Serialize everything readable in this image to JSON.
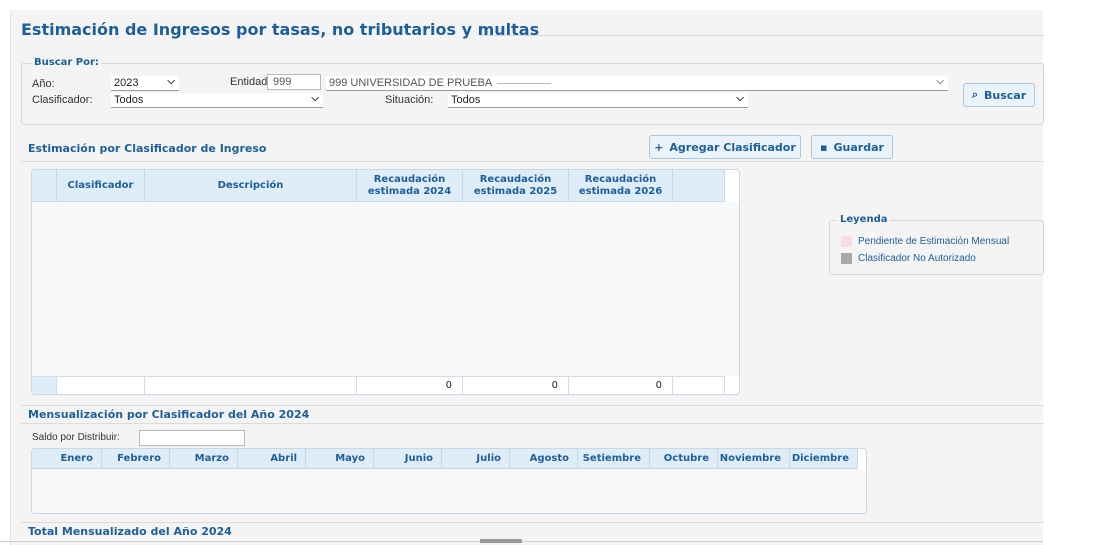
{
  "page": {
    "title": "Estimación de Ingresos por tasas, no tributarios y multas"
  },
  "search": {
    "legend": "Buscar Por:",
    "anio_label": "Año:",
    "anio_value": "2023",
    "entidad_label": "Entidad:",
    "entidad_code": "999",
    "entidad_select": "999  UNIVERSIDAD DE PRUEBA",
    "clasificador_label": "Clasificador:",
    "clasificador_value": "Todos",
    "situacion_label": "Situación:",
    "situacion_value": "Todos",
    "buscar_button": "Buscar"
  },
  "estimacion": {
    "title": "Estimación por Clasificador de Ingreso",
    "add_button": "Agregar Clasificador",
    "save_button": "Guardar",
    "columns": [
      "Clasificador",
      "Descripción",
      "Recaudación estimada 2024",
      "Recaudación estimada 2025",
      "Recaudación estimada 2026"
    ],
    "col2024_l1": "Recaudación",
    "col2024_l2": "estimada 2024",
    "col2025_l1": "Recaudación",
    "col2025_l2": "estimada 2025",
    "col2026_l1": "Recaudación",
    "col2026_l2": "estimada 2026",
    "totals": [
      "0",
      "0",
      "0"
    ]
  },
  "leyenda": {
    "title": "Leyenda",
    "items": [
      {
        "label": "Pendiente de Estimación Mensual",
        "color": "#f9dde3"
      },
      {
        "label": "Clasificador No Autorizado",
        "color": "#a9a9a9"
      }
    ]
  },
  "mensual": {
    "title": "Mensualización por Clasificador del Año 2024",
    "saldo_label": "Saldo por Distribuir:",
    "saldo_value": "",
    "months": [
      "Enero",
      "Febrero",
      "Marzo",
      "Abril",
      "Mayo",
      "Junio",
      "Julio",
      "Agosto",
      "Setiembre",
      "Octubre",
      "Noviembre",
      "Diciembre"
    ]
  },
  "total": {
    "title": "Total Mensualizado del Año 2024"
  }
}
